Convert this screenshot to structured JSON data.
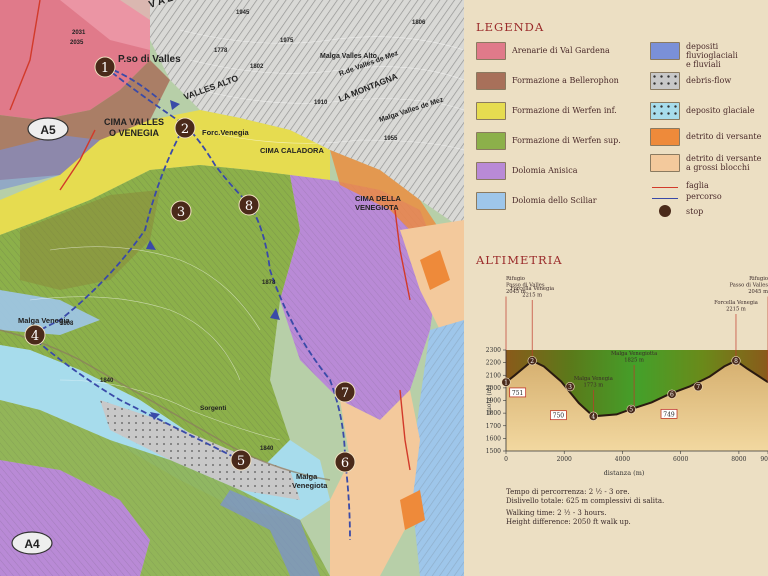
{
  "map": {
    "stops": [
      "1",
      "2",
      "3",
      "4",
      "5",
      "6",
      "7",
      "8"
    ],
    "route_badges": [
      "A5",
      "A4"
    ],
    "places": {
      "passo": "P.so di Valles",
      "cima_valles": "CIMA VALLES",
      "o_venegia": "O VENEGIA",
      "forc_venegia": "Forc.Venegia",
      "cima_caladora": "CIMA CALADORA",
      "cima_venegiota_1": "CIMA DELLA",
      "cima_venegiota_2": "VENEGIOTA",
      "malga_venegia": "Malga Venegia",
      "malga_venegiota_1": "Malga",
      "malga_venegiota_2": "Venegiota",
      "malga_valles_alto": "Malga Valles Alto",
      "valles_alto": "VALLES ALTO",
      "la_montagna": "LA MONTAGNA",
      "r_valles_mez": "R.de Valles de Mez",
      "malga_valles_mez": "Malga Valles de Mez",
      "valle": "V A L L E",
      "sorgenti": "Sorgenti"
    },
    "elevations": [
      "2031",
      "2035",
      "1945",
      "1975",
      "1806",
      "1778",
      "1802",
      "1955",
      "1910",
      "1878",
      "1840",
      "1840",
      "1808"
    ],
    "colors": {
      "arenarie": "#e07a8a",
      "bellerophon": "#a8705a",
      "werfen_inf": "#e6dc50",
      "werfen_sup": "#8cb04a",
      "anisica": "#b98ad6",
      "sciliar": "#9ec6ea",
      "fluvio": "#7a90d8",
      "debris": "#c8c8c8",
      "glaciale": "#a7dcec",
      "detrito": "#ee8a3a",
      "blocchi": "#f3c99c",
      "faglia": "#d23a2a",
      "percorso": "#3a4aa8",
      "stop": "#4a2a1a"
    }
  },
  "legend": {
    "title": "LEGENDA",
    "left": [
      {
        "label": "Arenarie di Val Gardena",
        "color": "#e07a8a"
      },
      {
        "label": "Formazione a Bellerophon",
        "color": "#a8705a"
      },
      {
        "label": "Formazione di Werfen inf.",
        "color": "#e6dc50"
      },
      {
        "label": "Formazione di Werfen sup.",
        "color": "#8cb04a"
      },
      {
        "label": "Dolomia Anisica",
        "color": "#b98ad6"
      },
      {
        "label": "Dolomia dello Sciliar",
        "color": "#9ec6ea"
      }
    ],
    "right": [
      {
        "label1": "depositi fluvioglaciali",
        "label2": "e fluviali",
        "color": "#7a90d8",
        "pattern": false
      },
      {
        "label1": "debris-flow",
        "label2": "",
        "color": "#c8c8c8",
        "pattern": true
      },
      {
        "label1": "deposito glaciale",
        "label2": "",
        "color": "#a7dcec",
        "pattern": true
      },
      {
        "label1": "detrito di versante",
        "label2": "",
        "color": "#ee8a3a",
        "pattern": false
      },
      {
        "label1": "detrito di versante",
        "label2": "a grossi blocchi",
        "color": "#f3c99c",
        "pattern": false
      }
    ],
    "faglia": "faglia",
    "percorso": "percorso",
    "stop": "stop"
  },
  "altimetria": {
    "title": "ALTIMETRIA",
    "ylabel": "quota (m)",
    "xlabel": "distanza (m)",
    "y_ticks": [
      "1500",
      "1600",
      "1700",
      "1800",
      "1900",
      "2000",
      "2100",
      "2200",
      "2300"
    ],
    "x_ticks": [
      "0",
      "2000",
      "4000",
      "6000",
      "8000",
      "9000"
    ],
    "chart_data": {
      "type": "area",
      "xlabel": "distanza (m)",
      "ylabel": "quota (m)",
      "ylim": [
        1500,
        2300
      ],
      "xlim": [
        0,
        9000
      ],
      "x": [
        0,
        300,
        900,
        1300,
        1900,
        2500,
        3000,
        3800,
        4400,
        5000,
        5600,
        6300,
        7000,
        7500,
        7900,
        8300,
        8700,
        9000
      ],
      "y": [
        2045,
        2100,
        2215,
        2170,
        2050,
        1880,
        1775,
        1790,
        1840,
        1885,
        1950,
        2010,
        2090,
        2170,
        2215,
        2150,
        2090,
        2045
      ],
      "stops": [
        {
          "label": "1",
          "x": 0,
          "y": 2045
        },
        {
          "label": "2",
          "x": 900,
          "y": 2215
        },
        {
          "label": "3",
          "x": 2200,
          "y": 2010
        },
        {
          "label": "4",
          "x": 3000,
          "y": 1775
        },
        {
          "label": "5",
          "x": 4300,
          "y": 1830
        },
        {
          "label": "6",
          "x": 5700,
          "y": 1950
        },
        {
          "label": "7",
          "x": 6600,
          "y": 2010
        },
        {
          "label": "8",
          "x": 7900,
          "y": 2215
        }
      ],
      "road_labels": [
        {
          "label": "751",
          "x": 400,
          "y": 1960
        },
        {
          "label": "750",
          "x": 1800,
          "y": 1780
        },
        {
          "label": "749",
          "x": 5600,
          "y": 1790
        }
      ],
      "annotations": [
        {
          "lines": [
            "Rifugio",
            "Passo di Valles",
            "2045 m"
          ],
          "x": 0
        },
        {
          "lines": [
            "Forcella Venegia",
            "2215 m"
          ],
          "x": 900
        },
        {
          "lines": [
            "Malga Venegia",
            "1773 m"
          ],
          "x": 3000
        },
        {
          "lines": [
            "Malga Venegiotta",
            "1825 m"
          ],
          "x": 4400
        },
        {
          "lines": [
            "Forcella Venegia",
            "2215 m"
          ],
          "x": 7900
        },
        {
          "lines": [
            "Rifugio",
            "Passo di Valles",
            "2045 m"
          ],
          "x": 9000
        }
      ]
    }
  },
  "footer": {
    "tempo_label": "Tempo di percorrenza:",
    "tempo_value": "2 ½ - 3 ore.",
    "disl_label": "Dislivello totale:",
    "disl_value": "625 m complessivi di salita.",
    "walk_label": "Walking time:",
    "walk_value": "2 ½ - 3 hours.",
    "height_label": "Height difference:",
    "height_value": "2050 ft walk up."
  }
}
